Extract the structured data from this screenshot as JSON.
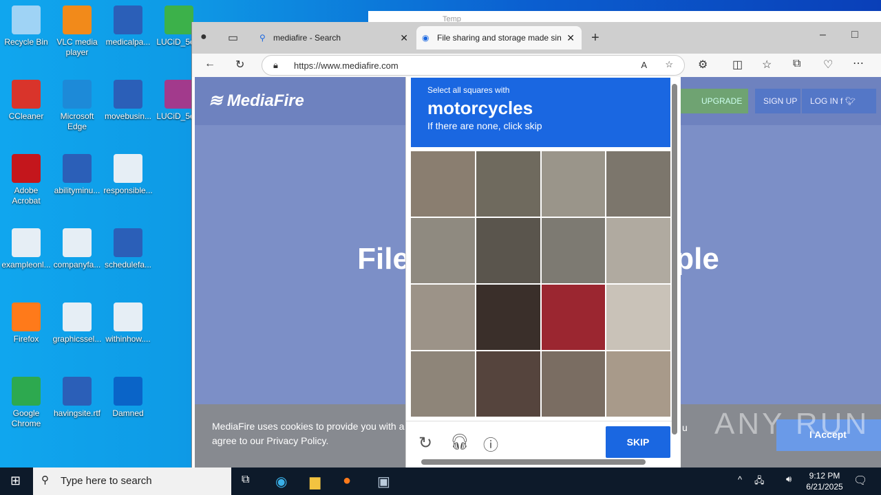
{
  "desktop": {
    "icons": [
      {
        "label": "Recycle Bin",
        "color": "#9fd3f5"
      },
      {
        "label": "VLC media player",
        "color": "#f28a1a"
      },
      {
        "label": "medicalpa...",
        "color": "#2b5fb8"
      },
      {
        "label": "LUCiD_5e...",
        "color": "#3cb14a"
      },
      {
        "label": "CCleaner",
        "color": "#d9342b"
      },
      {
        "label": "Microsoft Edge",
        "color": "#1d8ad8"
      },
      {
        "label": "movebusin...",
        "color": "#2b5fb8"
      },
      {
        "label": "LUCiD_5e...",
        "color": "#a23a8c"
      },
      {
        "label": "Adobe Acrobat",
        "color": "#c4161c"
      },
      {
        "label": "abilityminu...",
        "color": "#2b5fb8"
      },
      {
        "label": "responsible...",
        "color": "#e6eef5"
      },
      {
        "label": "exampleonl...",
        "color": "#e6eef5"
      },
      {
        "label": "companyfa...",
        "color": "#e6eef5"
      },
      {
        "label": "schedulefa...",
        "color": "#2b5fb8"
      },
      {
        "label": "Firefox",
        "color": "#ff7a1a"
      },
      {
        "label": "graphicssel...",
        "color": "#e6eef5"
      },
      {
        "label": "withinhow....",
        "color": "#e6eef5"
      },
      {
        "label": "Google Chrome",
        "color": "#2da94f"
      },
      {
        "label": "havingsite.rtf",
        "color": "#2b5fb8"
      },
      {
        "label": "Damned",
        "color": "#0a64c8"
      }
    ]
  },
  "explorer": {
    "title": "Temp"
  },
  "browser": {
    "tabs": [
      {
        "label": "mediafire - Search"
      },
      {
        "label": "File sharing and storage made sin"
      }
    ],
    "url": "https://www.mediafire.com"
  },
  "mediafire": {
    "logo": "MediaFire",
    "upgrade": "UPGRADE",
    "signup": "SIGN UP",
    "login": "LOG IN",
    "hero": "File storage made simple",
    "cookie_line1": "MediaFire uses cookies to provide you with a p",
    "cookie_line1_end": "u",
    "cookie_line2": "agree to our Privacy Policy.",
    "accept": "I Accept"
  },
  "captcha": {
    "instruction": "Select all squares with",
    "target": "motorcycles",
    "hint": "If there are none, click skip",
    "skip": "SKIP"
  },
  "watermark": "ANY RUN",
  "taskbar": {
    "search_placeholder": "Type here to search",
    "time": "9:12 PM",
    "date": "6/21/2025"
  }
}
